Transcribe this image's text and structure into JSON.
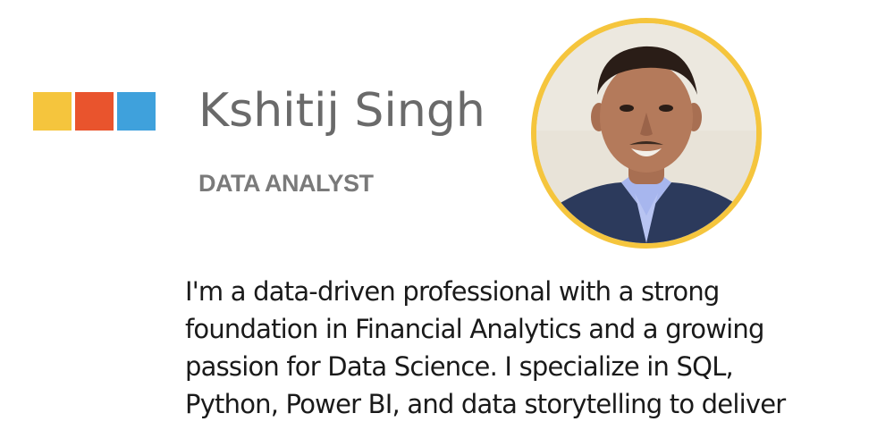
{
  "brand": {
    "squares": [
      "#f5c53d",
      "#e9542d",
      "#3fa1dc"
    ]
  },
  "profile": {
    "name": "Kshitij Singh",
    "role": "DATA ANALYST",
    "avatar_border_color": "#f5c53d"
  },
  "bio": {
    "lines": [
      "I'm a data-driven professional with a strong",
      "foundation in Financial Analytics and a growing",
      "passion for Data Science. I specialize in SQL,",
      "Python, Power BI, and data storytelling to deliver"
    ]
  }
}
